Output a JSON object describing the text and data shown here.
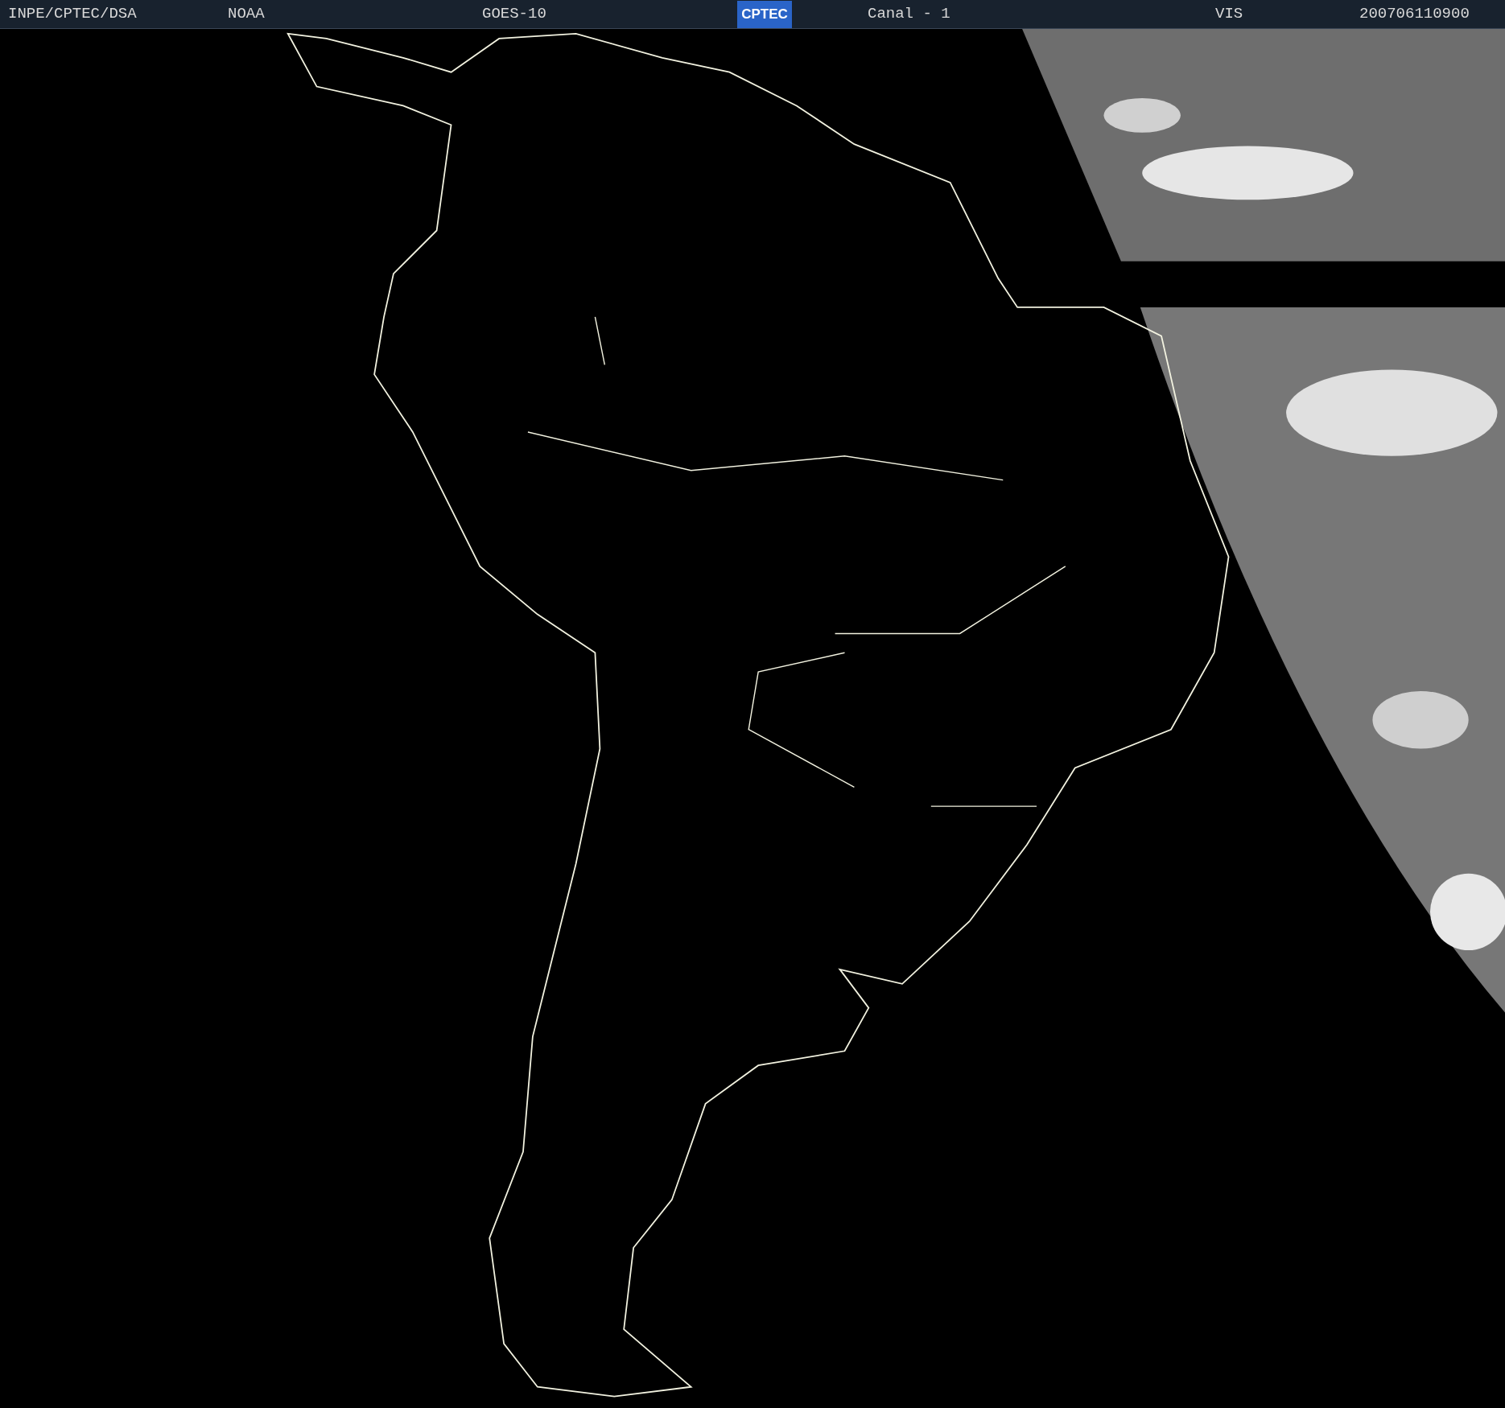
{
  "header": {
    "items": [
      {
        "kind": "text",
        "text": "INPE/CPTEC/DSA"
      },
      {
        "kind": "text",
        "text": "NOAA"
      },
      {
        "kind": "text",
        "text": "GOES-10"
      },
      {
        "kind": "logo",
        "text": "CPTEC"
      },
      {
        "kind": "text",
        "text": "Canal - 1"
      },
      {
        "kind": "text",
        "text": "VIS"
      },
      {
        "kind": "text",
        "text": "200706110900"
      }
    ]
  }
}
